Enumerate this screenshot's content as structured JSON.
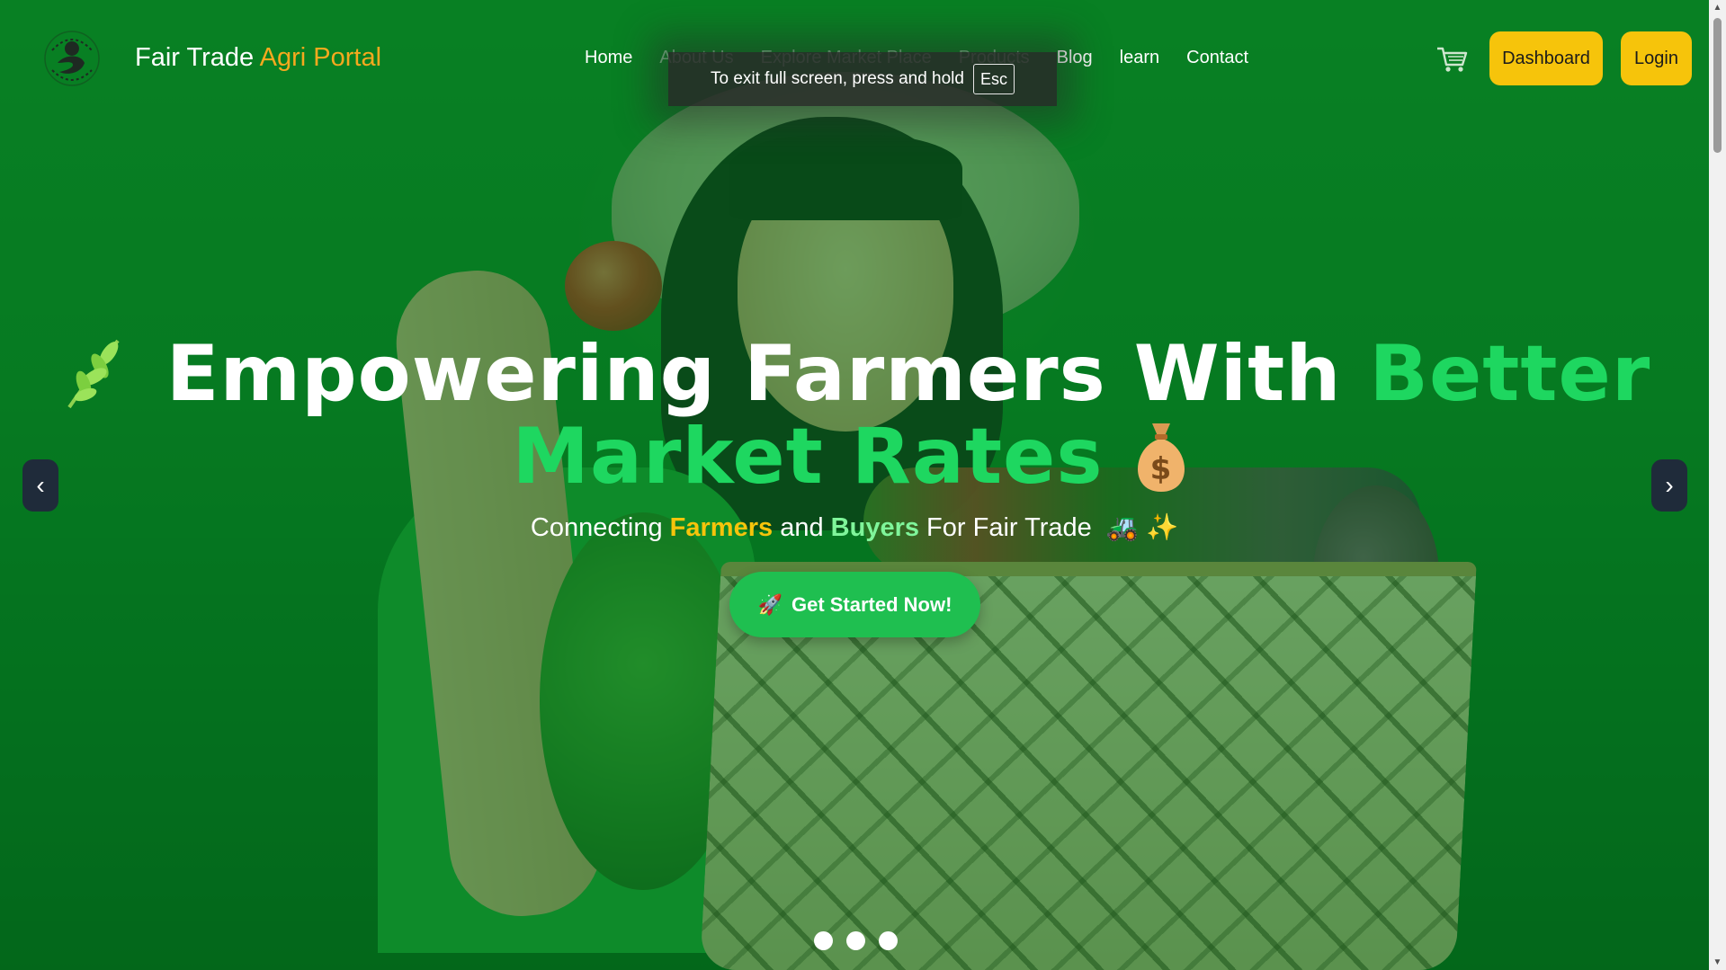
{
  "navbar": {
    "brand_main": "Fair Trade",
    "brand_accent": "Agri Portal",
    "logo_icon": "fair-trade-logo",
    "links": [
      "Home",
      "About Us",
      "Explore Market Place",
      "Products",
      "Blog",
      "learn",
      "Contact"
    ],
    "cart_icon": "shopping-cart-icon",
    "dashboard_label": "Dashboard",
    "login_label": "Login"
  },
  "fullscreen_toast": {
    "text": "To exit full screen, press and hold",
    "key": "Esc"
  },
  "hero": {
    "headline_white": "Empowering Farmers With",
    "headline_green_1": "Better",
    "headline_green_2": "Market Rates",
    "sub_1": "Connecting",
    "sub_farmers": "Farmers",
    "sub_and": "and",
    "sub_buyers": "Buyers",
    "sub_2": "For Fair Trade",
    "sub_emojis": "🚜 ✨",
    "cta_icon": "🚀",
    "cta_label": "Get Started Now!",
    "prev_label": "‹",
    "next_label": "›",
    "slides_count": 3
  },
  "colors": {
    "accent_orange": "#f6a91e",
    "button_yellow": "#f6c40b",
    "headline_green": "#1ed760",
    "cta_green": "#1fbf50",
    "overlay_green": "#0f7d27"
  }
}
